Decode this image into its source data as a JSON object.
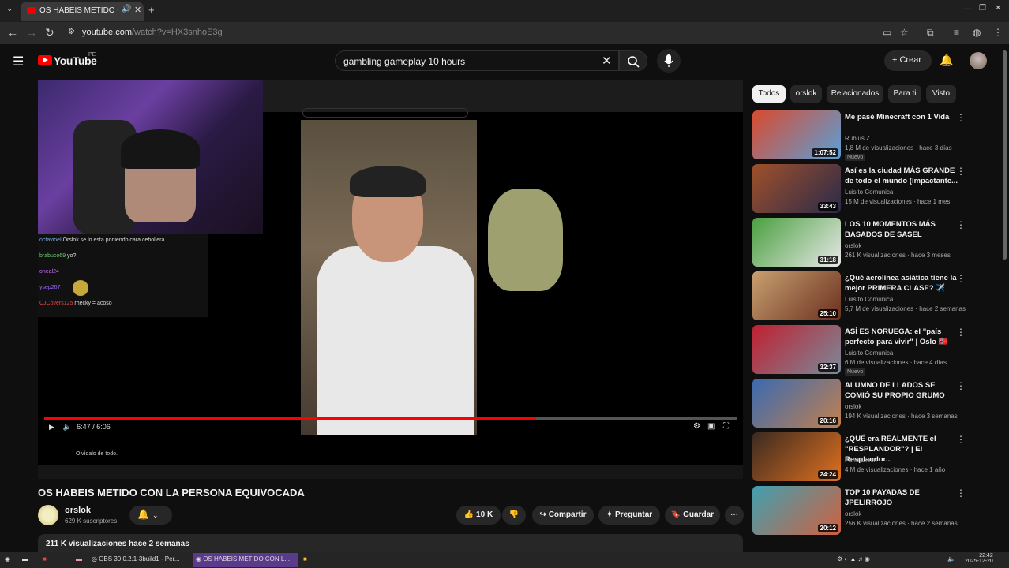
{
  "browser": {
    "tab_title": "OS HABEIS METIDO CON LA PERSONA EQUIVOCADA - YouTube",
    "url_host": "youtube.com",
    "url_path": "/watch?v=HX3snhoE3g"
  },
  "header": {
    "logo_text": "YouTube",
    "country_code": "PE",
    "search_value": "gambling gameplay 10 hours",
    "create_label": "Crear"
  },
  "stream": {
    "chat": [
      {
        "user": "octavioel",
        "text": "Orslok se lo esta poniendo cara cebollera"
      },
      {
        "user": "brabuco69",
        "text": "yo?"
      },
      {
        "user": "oneal24",
        "text": ""
      },
      {
        "user": "ysep267",
        "text": ""
      },
      {
        "user": "CJCovers125",
        "text": "rhecky = acoso"
      }
    ],
    "time_text": "6:47 / 6:06",
    "notice": "Olvídalo de todo.",
    "progress": 0.71
  },
  "video": {
    "title": "OS HABEIS METIDO CON LA PERSONA EQUIVOCADA",
    "channel": "orslok",
    "subscribers": "629 K suscriptores",
    "likes": "10 K",
    "share_label": "Compartir",
    "ask_label": "Preguntar",
    "save_label": "Guardar",
    "views_date": "211 K visualizaciones  hace 2 semanas"
  },
  "chips": [
    "Todos",
    "orslok",
    "Relacionados",
    "Para ti",
    "Visto"
  ],
  "recommendations": [
    {
      "title": "Me pasé Minecraft con 1 Vida",
      "channel": "Rubius Z",
      "meta": "1,8 M de visualizaciones · hace 3 días",
      "duration": "1:07:52",
      "badge": "Nuevo",
      "colors": [
        "#d94a2e",
        "#5aa0d8"
      ]
    },
    {
      "title": "Así es la ciudad MÁS GRANDE de todo el mundo (impactante...",
      "channel": "Luisito Comunica",
      "meta": "15 M de visualizaciones · hace 1 mes",
      "duration": "33:43",
      "badge": "",
      "colors": [
        "#a0502a",
        "#2a2a4a"
      ]
    },
    {
      "title": "LOS 10 MOMENTOS MÁS BASADOS DE SASEL",
      "channel": "orslok",
      "meta": "261 K visualizaciones · hace 3 meses",
      "duration": "31:18",
      "badge": "",
      "colors": [
        "#4aa040",
        "#e8e8e8"
      ]
    },
    {
      "title": "¿Qué aerolínea asiática tiene la mejor PRIMERA CLASE? ✈️",
      "channel": "Luisito Comunica",
      "meta": "5,7 M de visualizaciones · hace 2 semanas",
      "duration": "25:10",
      "badge": "",
      "colors": [
        "#c9a070",
        "#6a3020"
      ]
    },
    {
      "title": "ASÍ ES NORUEGA: el \"país perfecto para vivir\" | Oslo 🇳🇴",
      "channel": "Luisito Comunica",
      "meta": "6 M de visualizaciones · hace 4 días",
      "duration": "32:37",
      "badge": "Nuevo",
      "colors": [
        "#c02030",
        "#7a8a9a"
      ]
    },
    {
      "title": "ALUMNO DE LLADOS SE COMIÓ SU PROPIO GRUMO",
      "channel": "orslok",
      "meta": "194 K visualizaciones · hace 3 semanas",
      "duration": "20:16",
      "badge": "",
      "colors": [
        "#3a6ab0",
        "#c08050"
      ]
    },
    {
      "title": "¿QUÉ era REALMENTE el \"RESPLANDOR\"? | El Resplandor...",
      "channel": "Farid Dieck",
      "meta": "4 M de visualizaciones · hace 1 año",
      "duration": "24:24",
      "badge": "",
      "colors": [
        "#3a2a20",
        "#e07020"
      ]
    },
    {
      "title": "TOP 10 PAYADAS DE JPELIRROJO",
      "channel": "orslok",
      "meta": "256 K visualizaciones · hace 2 semanas",
      "duration": "20:12",
      "badge": "",
      "colors": [
        "#40a0b0",
        "#d06040"
      ]
    }
  ],
  "taskbar": {
    "obs": "OBS 30.0.2.1-3build1 - Per...",
    "browser": "OS HABEIS METIDO CON L...",
    "time": "22:42",
    "date": "2025-12-20"
  }
}
